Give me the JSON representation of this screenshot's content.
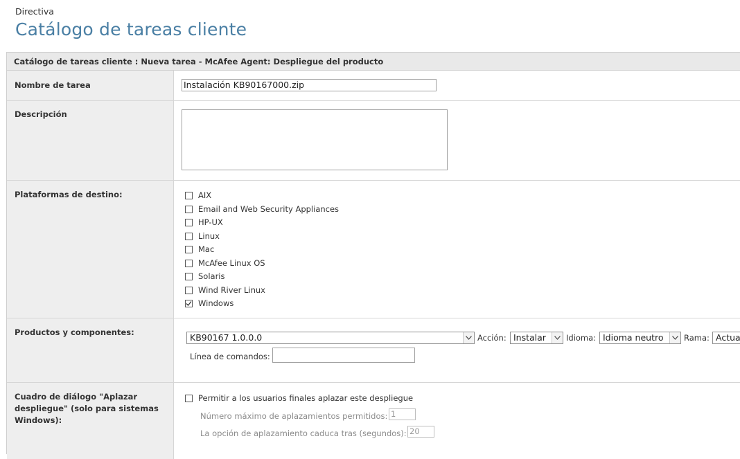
{
  "breadcrumb": "Directiva",
  "page_title": "Catálogo de tareas cliente",
  "panel_header": "Catálogo de tareas cliente : Nueva tarea - McAfee Agent: Despliegue del producto",
  "task_name": {
    "label": "Nombre de tarea",
    "value": "Instalación KB90167000.zip"
  },
  "description": {
    "label": "Descripción",
    "value": ""
  },
  "platforms": {
    "label": "Plataformas de destino:",
    "items": [
      {
        "label": "AIX",
        "checked": false
      },
      {
        "label": "Email and Web Security Appliances",
        "checked": false
      },
      {
        "label": "HP-UX",
        "checked": false
      },
      {
        "label": "Linux",
        "checked": false
      },
      {
        "label": "Mac",
        "checked": false
      },
      {
        "label": "McAfee Linux OS",
        "checked": false
      },
      {
        "label": "Solaris",
        "checked": false
      },
      {
        "label": "Wind River Linux",
        "checked": false
      },
      {
        "label": "Windows",
        "checked": true
      }
    ]
  },
  "products": {
    "label": "Productos y componentes:",
    "product_value": "KB90167 1.0.0.0",
    "action_label": "Acción:",
    "action_value": "Instalar",
    "language_label": "Idioma:",
    "language_value": "Idioma neutro",
    "branch_label": "Rama:",
    "branch_value": "Actual",
    "command_line_label": "Línea de comandos:",
    "command_line_value": ""
  },
  "postpone": {
    "label": "Cuadro de diálogo \"Aplazar despliegue\" (solo para sistemas Windows):",
    "allow_label": "Permitir a los usuarios finales aplazar este despliegue",
    "allow_checked": false,
    "max_label": "Número máximo de aplazamientos permitidos:",
    "max_value": "1",
    "expire_label": "La opción de aplazamiento caduca tras (segundos):",
    "expire_value": "20"
  }
}
